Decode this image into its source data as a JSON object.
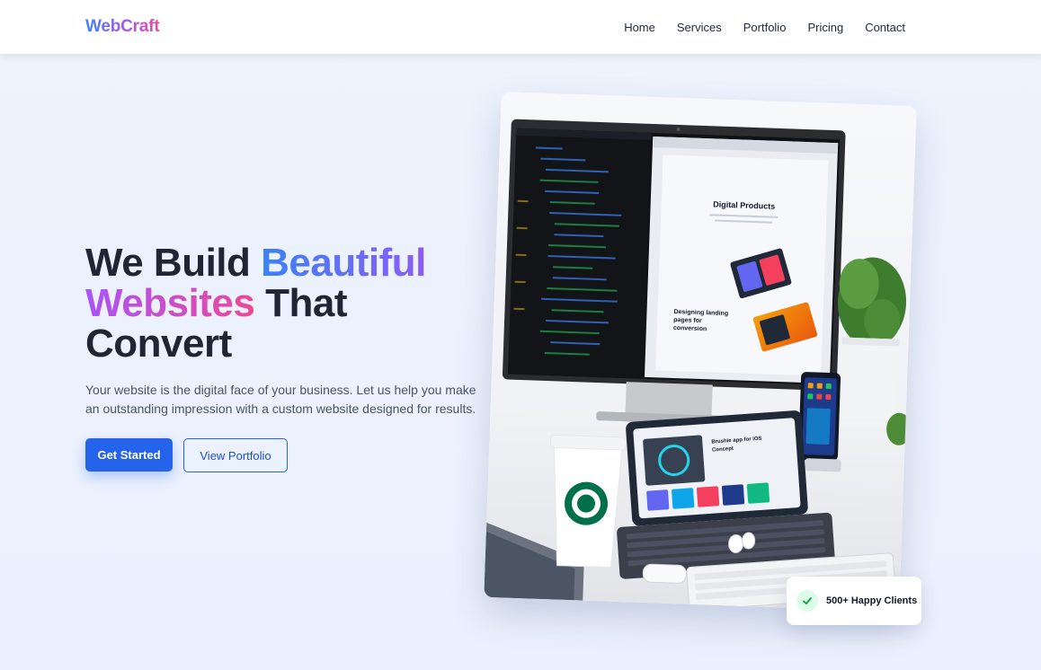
{
  "header": {
    "logo": "WebCraft",
    "nav": [
      {
        "label": "Home"
      },
      {
        "label": "Services"
      },
      {
        "label": "Portfolio"
      },
      {
        "label": "Pricing"
      },
      {
        "label": "Contact"
      }
    ]
  },
  "hero": {
    "title_part1": "We Build ",
    "title_part2": "Beautiful",
    "title_part3": "Websites",
    "title_part4": " That Convert",
    "subtitle": "Your website is the digital face of your business. Let us help you make an outstanding impression with a custom website designed for results.",
    "primary_button": "Get Started",
    "secondary_button": "View Portfolio"
  },
  "image": {
    "screen_heading": "Digital Products",
    "screen_tagline": "Designing landing pages for conversion",
    "tablet_heading": "Brushie app for iOS Concept",
    "icon": "workspace-photo"
  },
  "badge": {
    "text": "500+ Happy Clients",
    "icon": "check-icon"
  },
  "colors": {
    "primary": "#2563eb",
    "gradient_start": "#3b82f6",
    "gradient_mid": "#a855f7",
    "gradient_end": "#ec4899",
    "background": "#eef3fd"
  }
}
